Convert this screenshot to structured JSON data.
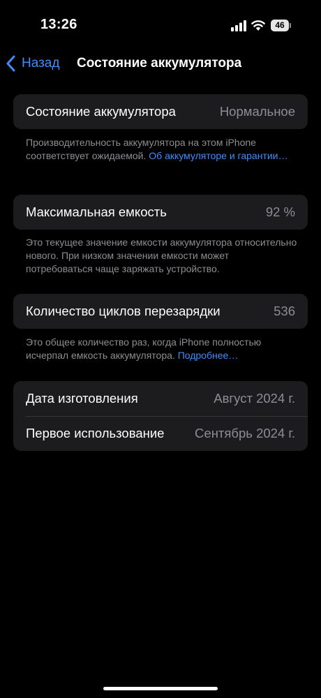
{
  "status_bar": {
    "time": "13:26",
    "battery_level": "46"
  },
  "nav": {
    "back_label": "Назад",
    "title": "Состояние аккумулятора"
  },
  "health": {
    "label": "Состояние аккумулятора",
    "value": "Нормальное",
    "note": "Производительность аккумулятора на этом iPhone соответствует ожидаемой.",
    "link": "Об аккумуляторе и гарантии…"
  },
  "capacity": {
    "label": "Максимальная емкость",
    "value": "92 %",
    "note": "Это текущее значение емкости аккумулятора относительно нового. При низком значении емкости может потребоваться чаще заряжать устройство."
  },
  "cycles": {
    "label": "Количество циклов перезарядки",
    "value": "536",
    "note": "Это общее количество раз, когда iPhone полностью исчерпал емкость аккумулятора.",
    "link": "Подробнее…"
  },
  "dates": {
    "manufacture_label": "Дата изготовления",
    "manufacture_value": "Август 2024 г.",
    "first_use_label": "Первое использование",
    "first_use_value": "Сентябрь 2024 г."
  },
  "colors": {
    "accent": "#3e8ef7",
    "cell": "#1c1c1e",
    "secondary_text": "#8d8d93"
  }
}
